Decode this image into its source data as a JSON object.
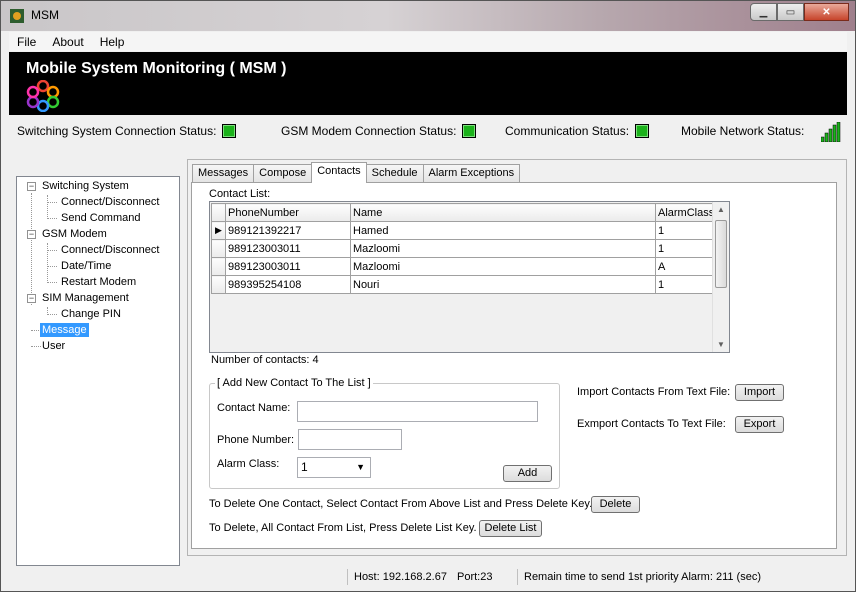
{
  "window": {
    "title": "MSM",
    "app_icon": "msm-app-icon"
  },
  "menu": [
    "File",
    "About",
    "Help"
  ],
  "header": {
    "title": "Mobile System Monitoring ( MSM )"
  },
  "status": {
    "switching_label": "Switching System Connection Status:",
    "gsm_label": "GSM Modem Connection Status:",
    "comm_label": "Communication Status:",
    "network_label": "Mobile Network Status:",
    "ok_color": "#1bb21b"
  },
  "tree": {
    "switching": "Switching System",
    "connect1": "Connect/Disconnect",
    "send_command": "Send Command",
    "gsm": "GSM Modem",
    "connect2": "Connect/Disconnect",
    "datetime": "Date/Time",
    "restart": "Restart Modem",
    "sim": "SIM Management",
    "pin": "Change PIN",
    "message": "Message",
    "user": "User"
  },
  "tabs": [
    "Messages",
    "Compose",
    "Contacts",
    "Schedule",
    "Alarm Exceptions"
  ],
  "contacts": {
    "list_label": "Contact List:",
    "columns": [
      "PhoneNumber",
      "Name",
      "AlarmClass"
    ],
    "rows": [
      [
        "989121392217",
        "Hamed",
        "1"
      ],
      [
        "989123003011",
        "Mazloomi",
        "1"
      ],
      [
        "989123003011",
        "Mazloomi",
        "A"
      ],
      [
        "989395254108",
        "Nouri",
        "1"
      ]
    ],
    "count_label": "Number of contacts: 4",
    "add_group_title": "[ Add New Contact To The List ]",
    "contact_name_label": "Contact Name:",
    "phone_label": "Phone Number:",
    "alarm_label": "Alarm Class:",
    "alarm_value": "1",
    "add_button": "Add",
    "import_label": "Import Contacts From Text File:",
    "import_button": "Import",
    "export_label": "Exmport Contacts To Text File:",
    "export_button": "Export",
    "delete_one_text": "To Delete One Contact, Select Contact From Above List and Press Delete Key.",
    "delete_button": "Delete",
    "delete_all_text": "To Delete, All Contact From List, Press Delete List Key.",
    "delete_list_button": "Delete List"
  },
  "statusbar": {
    "host": "Host: 192.168.2.67",
    "port": "Port:23",
    "remain": "Remain time to send 1st priority Alarm:  211 (sec)"
  }
}
